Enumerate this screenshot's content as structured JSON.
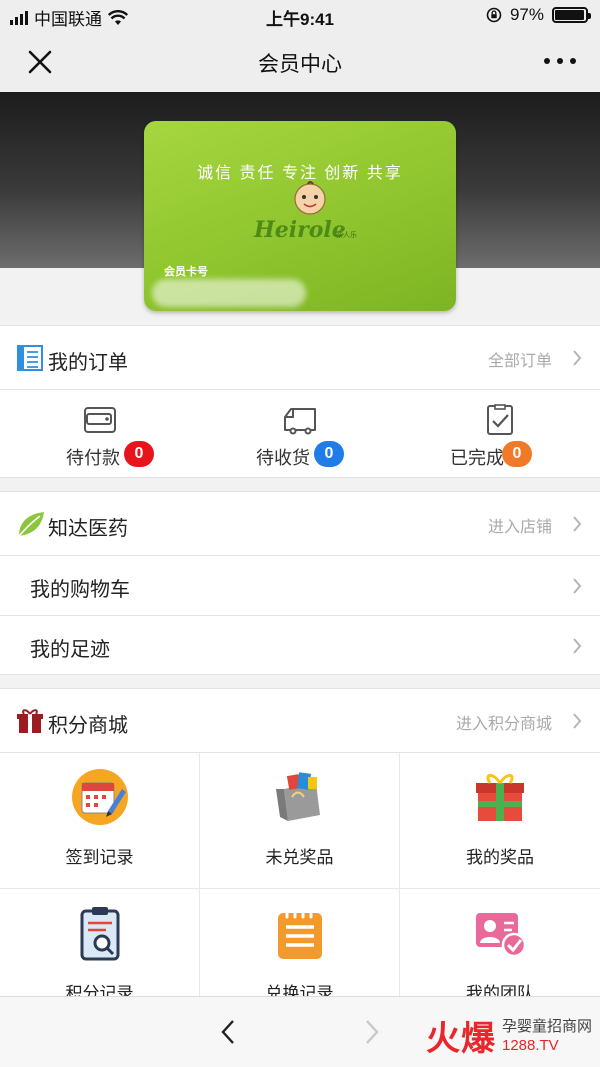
{
  "status_bar": {
    "carrier": "中国联通",
    "time": "上午9:41",
    "battery": "97%",
    "battery_level": 0.97
  },
  "nav": {
    "title": "会员中心"
  },
  "card": {
    "slogan": "诚信 责任 专注 创新 共享",
    "logo_text": "Heirole",
    "logo_sub": "亲人乐",
    "card_no_label": "会员卡号"
  },
  "orders": {
    "title": "我的订单",
    "link": "全部订单",
    "items": [
      {
        "label": "待付款",
        "count": "0",
        "color": "#e8141c"
      },
      {
        "label": "待收货",
        "count": "0",
        "color": "#1e7de8"
      },
      {
        "label": "已完成",
        "count": "0",
        "color": "#f07a28"
      }
    ]
  },
  "shop": {
    "title": "知达医药",
    "link": "进入店铺",
    "rows": [
      "我的购物车",
      "我的足迹"
    ]
  },
  "mall": {
    "title": "积分商城",
    "link": "进入积分商城",
    "items": [
      {
        "label": "签到记录",
        "icon": "calendar-icon"
      },
      {
        "label": "未兑奖品",
        "icon": "gift-bag-icon"
      },
      {
        "label": "我的奖品",
        "icon": "gift-box-icon"
      },
      {
        "label": "积分记录",
        "icon": "clipboard-search-icon"
      },
      {
        "label": "兑换记录",
        "icon": "notepad-icon"
      },
      {
        "label": "我的团队",
        "icon": "team-card-icon"
      }
    ]
  },
  "watermark": {
    "big": "火爆",
    "line1": "孕婴童招商网",
    "line2": "1288.TV"
  },
  "colors": {
    "card_green": "#8fc52e",
    "badge_red": "#e8141c",
    "badge_blue": "#1e7de8",
    "badge_orange": "#f07a28",
    "watermark_red": "#e8262b"
  }
}
